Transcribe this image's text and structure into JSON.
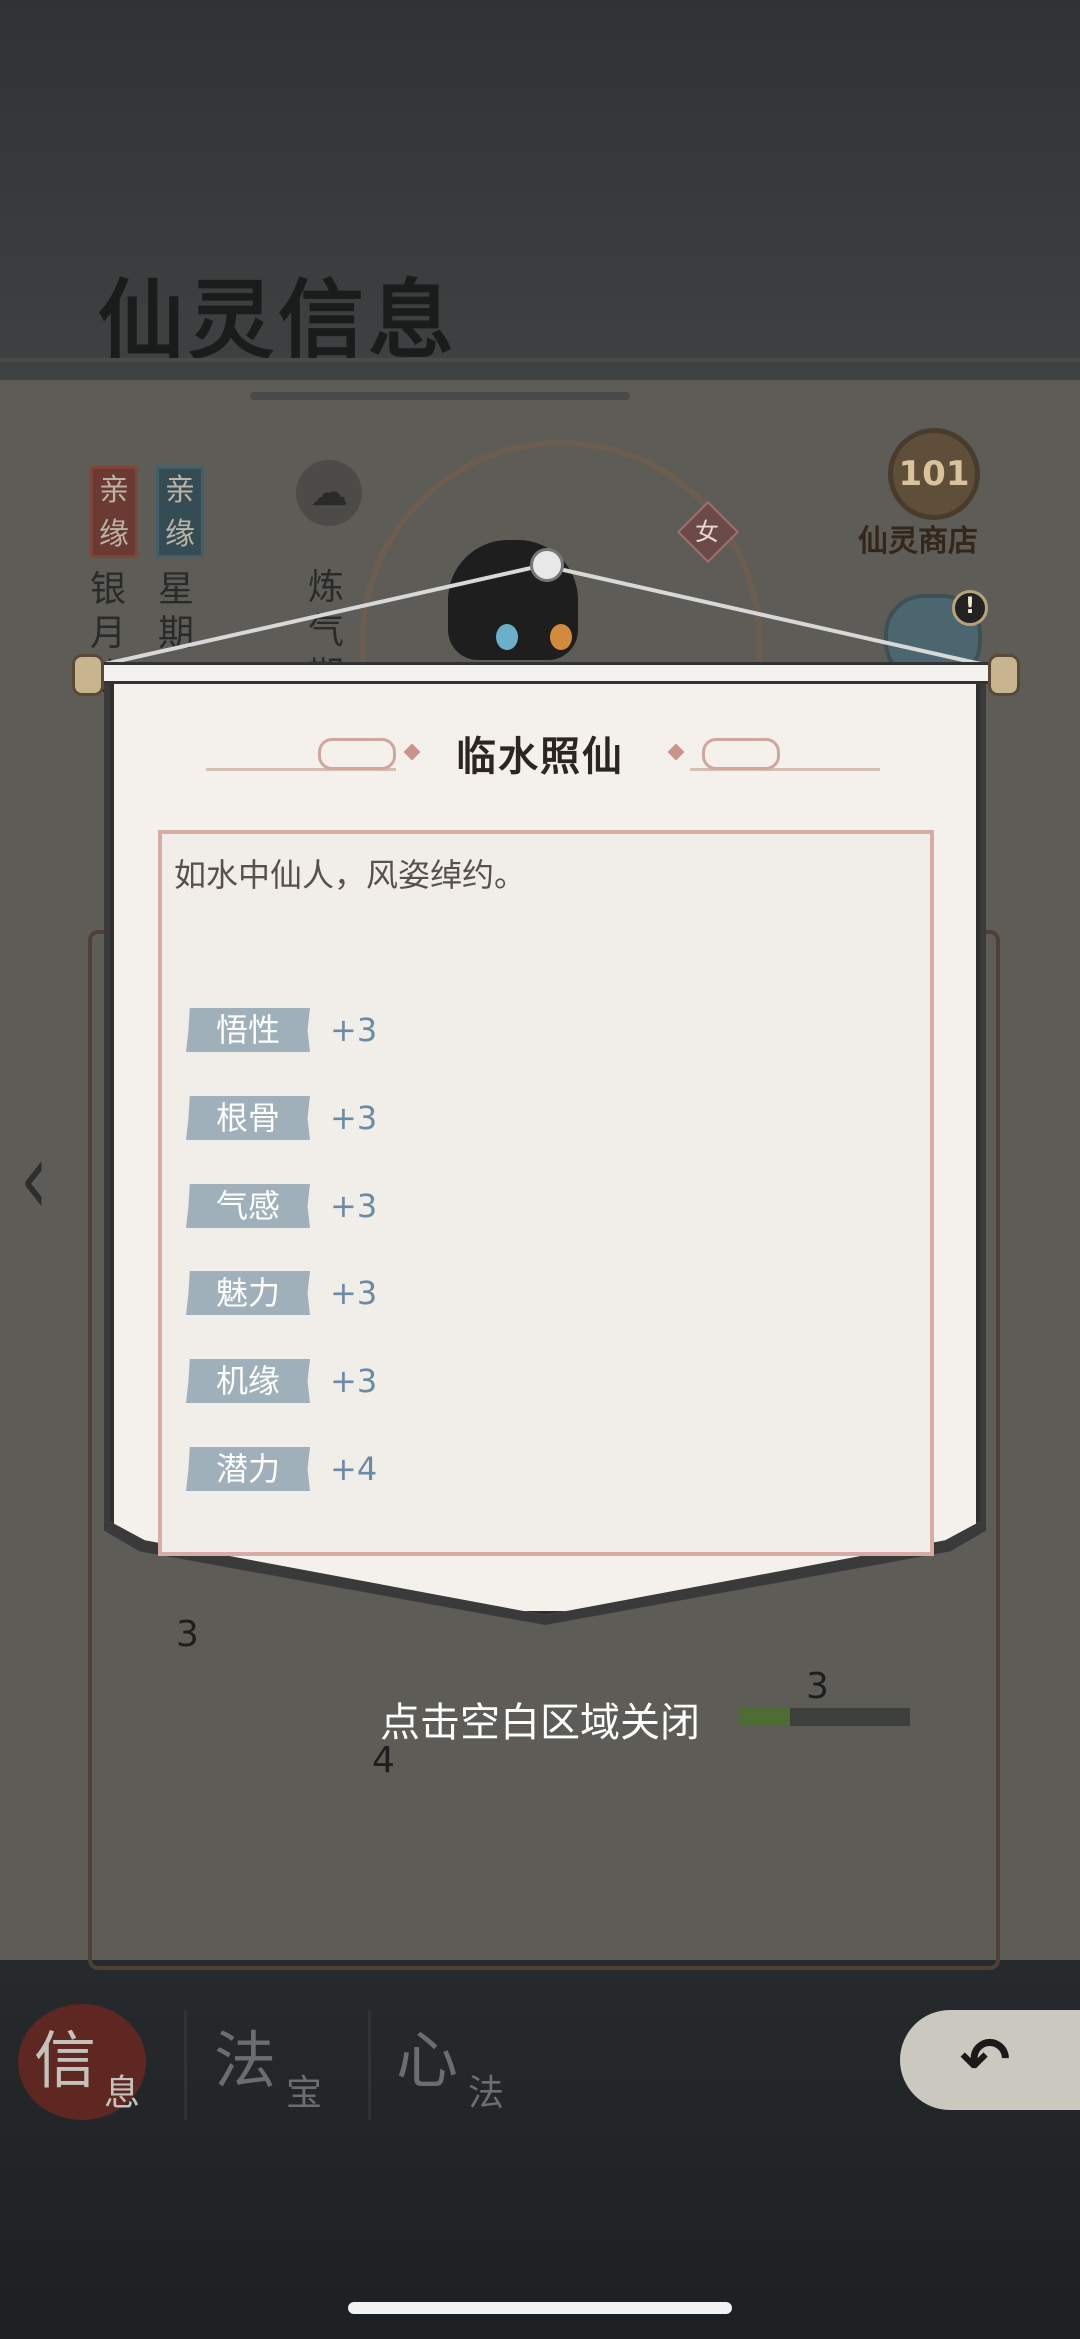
{
  "page": {
    "title": "仙灵信息",
    "shop_label": "仙灵商店",
    "shop_icon_glyph": "101",
    "gender": "女",
    "alert_badge": "!",
    "back_arrow": "‹",
    "bond_tags": [
      {
        "line1": "亲",
        "line2": "缘",
        "color": "red"
      },
      {
        "line1": "亲",
        "line2": "缘",
        "color": "blue"
      }
    ],
    "names": [
      {
        "text": "银月班"
      },
      {
        "text": "星期"
      }
    ],
    "realm_text": "炼气期",
    "bg_numbers": [
      "3",
      "3",
      "4"
    ]
  },
  "modal": {
    "title": "临水照仙",
    "description": "如水中仙人，风姿绰约。",
    "stats": [
      {
        "label": "悟性",
        "value": "+3"
      },
      {
        "label": "根骨",
        "value": "+3"
      },
      {
        "label": "气感",
        "value": "+3"
      },
      {
        "label": "魅力",
        "value": "+3"
      },
      {
        "label": "机缘",
        "value": "+3"
      },
      {
        "label": "潜力",
        "value": "+4"
      }
    ],
    "close_hint": "点击空白区域关闭"
  },
  "tabs": [
    {
      "big": "信",
      "small": "息",
      "active": true
    },
    {
      "big": "法",
      "small": "宝",
      "active": false
    },
    {
      "big": "心",
      "small": "法",
      "active": false
    }
  ],
  "back_button": "↶",
  "colors": {
    "stat_label_bg": "#9fb0bb",
    "stat_value": "#6b8aa6",
    "desc_border": "#d8aca4",
    "paper": "#f4f1ec",
    "active_tab": "#5e2722"
  }
}
